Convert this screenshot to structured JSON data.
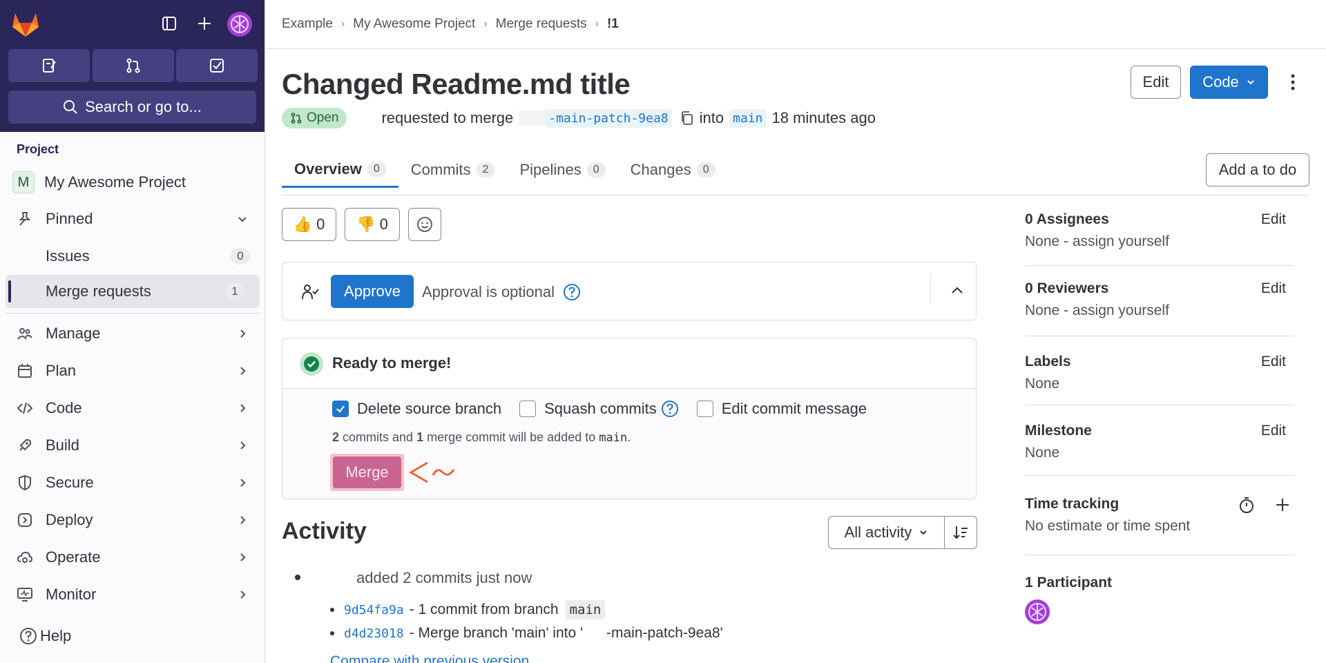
{
  "sidebar": {
    "search_placeholder": "Search or go to...",
    "section_label": "Project",
    "project": {
      "initial": "M",
      "name": "My Awesome Project"
    },
    "pinned_label": "Pinned",
    "pinned_items": [
      {
        "label": "Issues",
        "count": "0"
      },
      {
        "label": "Merge requests",
        "count": "1"
      }
    ],
    "menu": [
      {
        "label": "Manage"
      },
      {
        "label": "Plan"
      },
      {
        "label": "Code"
      },
      {
        "label": "Build"
      },
      {
        "label": "Secure"
      },
      {
        "label": "Deploy"
      },
      {
        "label": "Operate"
      },
      {
        "label": "Monitor"
      }
    ],
    "help_label": "Help"
  },
  "breadcrumb": [
    "Example",
    "My Awesome Project",
    "Merge requests",
    "!1"
  ],
  "mr": {
    "title": "Changed Readme.md title",
    "state": "Open",
    "requested_text": "requested to merge",
    "source_branch": "-main-patch-9ea8",
    "into_text": "into",
    "target_branch": "main",
    "time_ago": "18 minutes ago"
  },
  "header_buttons": {
    "edit": "Edit",
    "code": "Code"
  },
  "tabs": [
    {
      "label": "Overview",
      "count": "0"
    },
    {
      "label": "Commits",
      "count": "2"
    },
    {
      "label": "Pipelines",
      "count": "0"
    },
    {
      "label": "Changes",
      "count": "0"
    }
  ],
  "todo_button": "Add a to do",
  "reactions": {
    "thumbs_up": "0",
    "thumbs_down": "0"
  },
  "approval": {
    "button": "Approve",
    "text": "Approval is optional"
  },
  "merge": {
    "status": "Ready to merge!",
    "options": {
      "delete_source": "Delete source branch",
      "squash": "Squash commits",
      "edit_message": "Edit commit message"
    },
    "note": {
      "commits": "2",
      "commits_text": "commits and",
      "merge_commits": "1",
      "merge_text": "merge commit will be added to",
      "branch": "main",
      "end": "."
    },
    "button": "Merge",
    "annotation_color": "#e8663d"
  },
  "activity": {
    "title": "Activity",
    "filter": "All activity",
    "event": "added 2 commits just now",
    "commits": [
      {
        "sha": "9d54fa9a",
        "text": "- 1 commit from branch",
        "branch": "main"
      },
      {
        "sha": "d4d23018",
        "text": "- Merge branch 'main' into '",
        "suffix": "-main-patch-9ea8'"
      }
    ],
    "compare_link": "Compare with previous version"
  },
  "right_sidebar": {
    "assignees": {
      "title": "0 Assignees",
      "value": "None - assign yourself",
      "edit": "Edit"
    },
    "reviewers": {
      "title": "0 Reviewers",
      "value": "None -  assign yourself",
      "edit": "Edit"
    },
    "labels": {
      "title": "Labels",
      "value": "None",
      "edit": "Edit"
    },
    "milestone": {
      "title": "Milestone",
      "value": "None",
      "edit": "Edit"
    },
    "time_tracking": {
      "title": "Time tracking",
      "value": "No estimate or time spent"
    },
    "participants": {
      "title": "1 Participant"
    }
  },
  "colors": {
    "brand_dark": "#2b2659",
    "accent": "#1f75cb",
    "merge_button": "#c96592",
    "open_badge": "#c3e6cd"
  }
}
